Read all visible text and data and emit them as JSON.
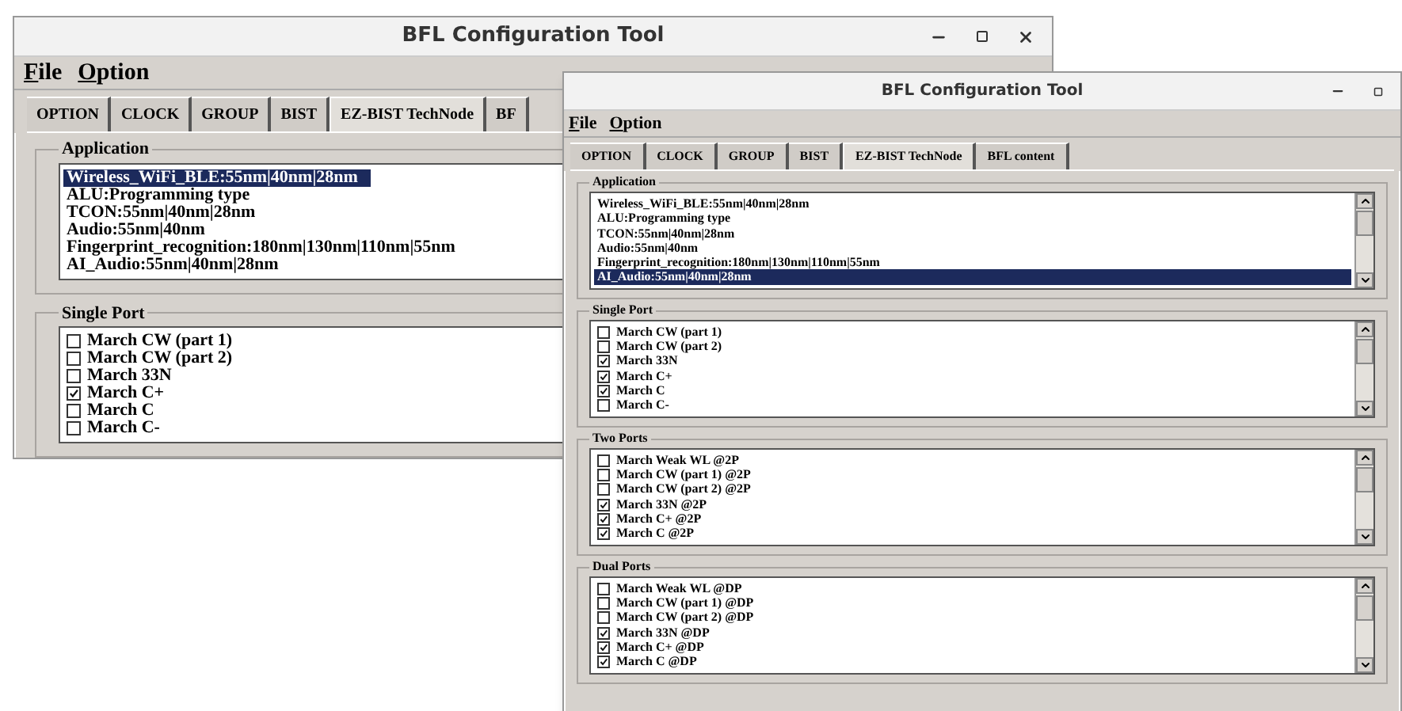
{
  "windows": [
    {
      "title": "BFL Configuration Tool",
      "controls": [
        {
          "kind": "minimize"
        },
        {
          "kind": "maximize"
        },
        {
          "kind": "close"
        }
      ],
      "menu": [
        "File",
        "Option"
      ],
      "tabs": [
        {
          "label": "OPTION",
          "selected": false
        },
        {
          "label": "CLOCK",
          "selected": false
        },
        {
          "label": "GROUP",
          "selected": false
        },
        {
          "label": "BIST",
          "selected": false
        },
        {
          "label": "EZ-BIST TechNode",
          "selected": true
        },
        {
          "label": "BF",
          "selected": false
        }
      ],
      "groups": [
        {
          "title": "Application",
          "kind": "list",
          "items": [
            {
              "label": "Wireless_WiFi_BLE:55nm|40nm|28nm",
              "selected": true
            },
            {
              "label": "ALU:Programming type",
              "selected": false
            },
            {
              "label": "TCON:55nm|40nm|28nm",
              "selected": false
            },
            {
              "label": "Audio:55nm|40nm",
              "selected": false
            },
            {
              "label": "Fingerprint_recognition:180nm|130nm|110nm|55nm",
              "selected": false
            },
            {
              "label": "AI_Audio:55nm|40nm|28nm",
              "selected": false
            }
          ]
        },
        {
          "title": "Single Port",
          "kind": "checklist",
          "items": [
            {
              "label": "March CW (part 1)",
              "checked": false
            },
            {
              "label": "March CW (part 2)",
              "checked": false
            },
            {
              "label": "March 33N",
              "checked": false
            },
            {
              "label": "March C+",
              "checked": true
            },
            {
              "label": "March C",
              "checked": false
            },
            {
              "label": "March C-",
              "checked": false
            }
          ]
        }
      ]
    },
    {
      "title": "BFL Configuration Tool",
      "controls": [
        {
          "kind": "minimize"
        },
        {
          "kind": "maximize"
        }
      ],
      "menu": [
        "File",
        "Option"
      ],
      "tabs": [
        {
          "label": "OPTION",
          "selected": false
        },
        {
          "label": "CLOCK",
          "selected": false
        },
        {
          "label": "GROUP",
          "selected": false
        },
        {
          "label": "BIST",
          "selected": false
        },
        {
          "label": "EZ-BIST TechNode",
          "selected": true
        },
        {
          "label": "BFL content",
          "selected": false
        }
      ],
      "groups": [
        {
          "title": "Application",
          "kind": "list",
          "items": [
            {
              "label": "Wireless_WiFi_BLE:55nm|40nm|28nm",
              "selected": false
            },
            {
              "label": "ALU:Programming type",
              "selected": false
            },
            {
              "label": "TCON:55nm|40nm|28nm",
              "selected": false
            },
            {
              "label": "Audio:55nm|40nm",
              "selected": false
            },
            {
              "label": "Fingerprint_recognition:180nm|130nm|110nm|55nm",
              "selected": false
            },
            {
              "label": "AI_Audio:55nm|40nm|28nm",
              "selected": true
            }
          ]
        },
        {
          "title": "Single Port",
          "kind": "checklist",
          "items": [
            {
              "label": "March CW (part 1)",
              "checked": false
            },
            {
              "label": "March CW (part 2)",
              "checked": false
            },
            {
              "label": "March 33N",
              "checked": true
            },
            {
              "label": "March C+",
              "checked": true
            },
            {
              "label": "March C",
              "checked": true
            },
            {
              "label": "March C-",
              "checked": false
            }
          ]
        },
        {
          "title": "Two Ports",
          "kind": "checklist",
          "items": [
            {
              "label": "March Weak WL @2P",
              "checked": false
            },
            {
              "label": "March CW (part 1) @2P",
              "checked": false
            },
            {
              "label": "March CW (part 2) @2P",
              "checked": false
            },
            {
              "label": "March 33N @2P",
              "checked": true
            },
            {
              "label": "March C+ @2P",
              "checked": true
            },
            {
              "label": "March C @2P",
              "checked": true
            }
          ]
        },
        {
          "title": "Dual Ports",
          "kind": "checklist",
          "items": [
            {
              "label": "March Weak WL @DP",
              "checked": false
            },
            {
              "label": "March CW (part 1) @DP",
              "checked": false
            },
            {
              "label": "March CW (part 2) @DP",
              "checked": false
            },
            {
              "label": "March 33N @DP",
              "checked": true
            },
            {
              "label": "March C+ @DP",
              "checked": true
            },
            {
              "label": "March C @DP",
              "checked": true
            }
          ]
        }
      ]
    }
  ]
}
